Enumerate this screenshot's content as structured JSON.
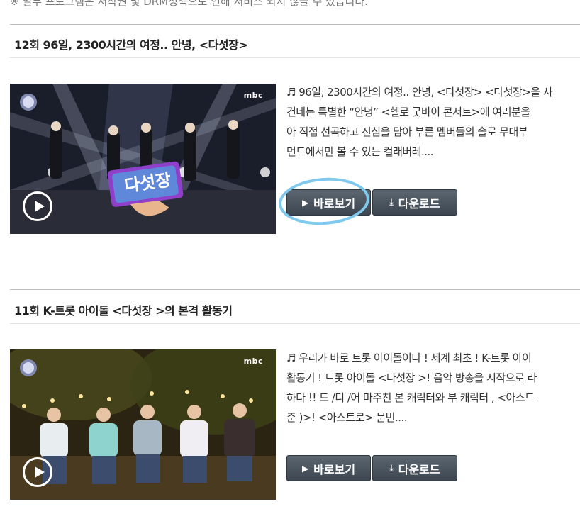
{
  "notice": "※ 일부 프로그램은 저작권 및 DRM정책으로 인해 서비스 되지 않을 수 있습니다.",
  "buttons": {
    "watch": "바로보기",
    "download": "다운로드"
  },
  "episodes": [
    {
      "title": "12회 96일, 2300시간의 여정.. 안녕, <다섯장>",
      "thumb_logo": "다섯장",
      "broadcaster": "mbc",
      "desc": [
        "♬ 96일, 2300시간의 여정.. 안녕, <다섯장> <다섯장>을 사",
        "건네는 특별한 “안녕” <헬로 굿바이 콘서트>에 여러분을",
        "아 직접 선곡하고 진심을 담아 부른 멤버들의 솔로 무대부",
        "먼트에서만 볼 수 있는 컬래버레...."
      ]
    },
    {
      "title": "11회 K-트롯 아이돌 <다섯장 >의 본격 활동기",
      "broadcaster": "mbc",
      "desc": [
        "♬ 우리가 바로 트롯 아이돌이다 ! 세계 최초 ! K-트롯 아이",
        "활동기 ! 트롯 아이돌 <다섯장 >! 음악 방송을 시작으로 라",
        "하다 !! 드 /디 /어 마주친 본 캐릭터와 부 캐릭터 , <아스트",
        "준 )>! <아스트로> 문빈...."
      ]
    }
  ],
  "colors": {
    "highlight": "#7fc8ee",
    "button": "#4a535c"
  }
}
